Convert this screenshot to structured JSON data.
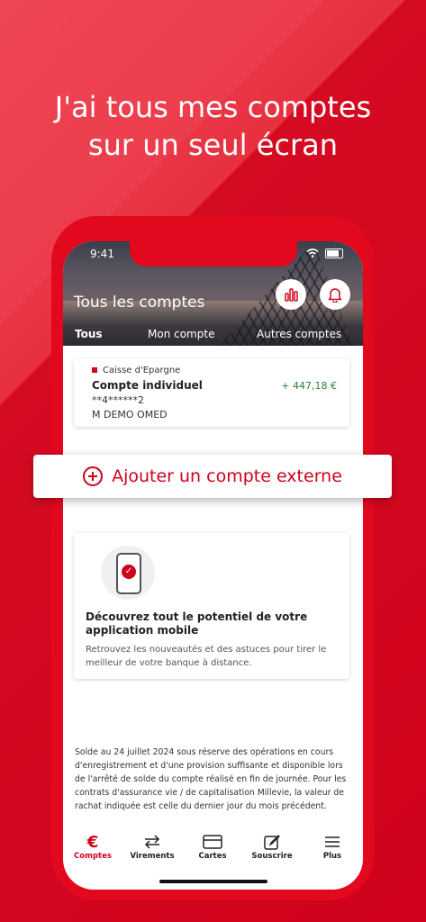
{
  "headline": {
    "line1": "J'ai tous mes comptes",
    "line2": "sur un seul écran"
  },
  "status_bar": {
    "time": "9:41"
  },
  "header": {
    "title": "Tous les comptes",
    "tabs": [
      {
        "label": "Tous",
        "active": true
      },
      {
        "label": "Mon compte",
        "active": false
      },
      {
        "label": "Autres comptes",
        "active": false
      }
    ]
  },
  "account": {
    "bank": "Caisse d'Epargne",
    "name": "Compte individuel",
    "amount": "+ 447,18 €",
    "number": "**4******2",
    "owner": "M DEMO OMED"
  },
  "add_external": {
    "label": "Ajouter un compte externe"
  },
  "promo": {
    "title": "Découvrez tout le potentiel de votre application mobile",
    "text": "Retrouvez les nouveautés et des astuces pour tirer le meilleur de votre banque à distance."
  },
  "disclaimer": "Solde au 24 juillet 2024 sous réserve des opérations en cours d'enregistrement et d'une provision suffisante et disponible lors de l'arrêté de solde du compte réalisé en fin de journée. Pour les contrats d'assurance vie / de capitalisation Millevie, la valeur de rachat indiquée est celle du dernier jour du mois précédent.",
  "nav": [
    {
      "label": "Comptes",
      "icon": "euro-icon",
      "active": true
    },
    {
      "label": "Virements",
      "icon": "transfer-arrows-icon",
      "active": false
    },
    {
      "label": "Cartes",
      "icon": "card-icon",
      "active": false
    },
    {
      "label": "Souscrire",
      "icon": "edit-pencil-icon",
      "active": false
    },
    {
      "label": "Plus",
      "icon": "menu-icon",
      "active": false
    }
  ],
  "colors": {
    "brand_red": "#d0021b",
    "positive_green": "#2e7d32"
  }
}
